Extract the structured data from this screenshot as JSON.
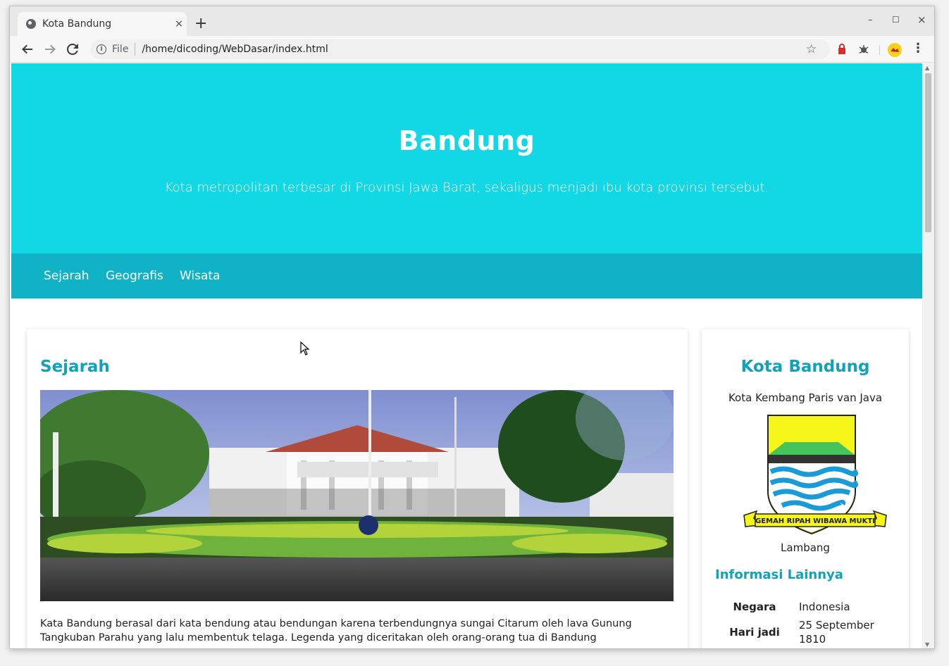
{
  "browser": {
    "tab_title": "Kota Bandung",
    "tab_close": "×",
    "new_tab": "+",
    "minimize": "–",
    "maximize": "☐",
    "close": "×",
    "scheme_label": "File",
    "url": "/home/dicoding/WebDasar/index.html"
  },
  "hero": {
    "title": "Bandung",
    "subtitle": "Kota metropolitan terbesar di Provinsi Jawa Barat, sekaligus menjadi ibu kota provinsi tersebut."
  },
  "nav": {
    "items": [
      {
        "label": "Sejarah"
      },
      {
        "label": "Geografis"
      },
      {
        "label": "Wisata"
      }
    ]
  },
  "main": {
    "heading": "Sejarah",
    "paragraph": "Kata Bandung berasal dari kata bendung atau bendungan karena terbendungnya sungai Citarum oleh lava Gunung Tangkuban Parahu yang lalu membentuk telaga. Legenda yang diceritakan oleh orang-orang tua di Bandung"
  },
  "aside": {
    "heading": "Kota Bandung",
    "tagline": "Kota Kembang Paris van Java",
    "emblem_motto": "GEMAH RIPAH WIBAWA MUKTI",
    "emblem_caption": "Lambang",
    "info_heading": "Informasi Lainnya",
    "info_rows": [
      {
        "label": "Negara",
        "value": "Indonesia"
      },
      {
        "label": "Hari jadi",
        "value": "25 September 1810"
      }
    ]
  },
  "colors": {
    "hero_bg": "#12d8e5",
    "nav_bg": "#0fb3c5",
    "accent": "#10a3b8"
  }
}
